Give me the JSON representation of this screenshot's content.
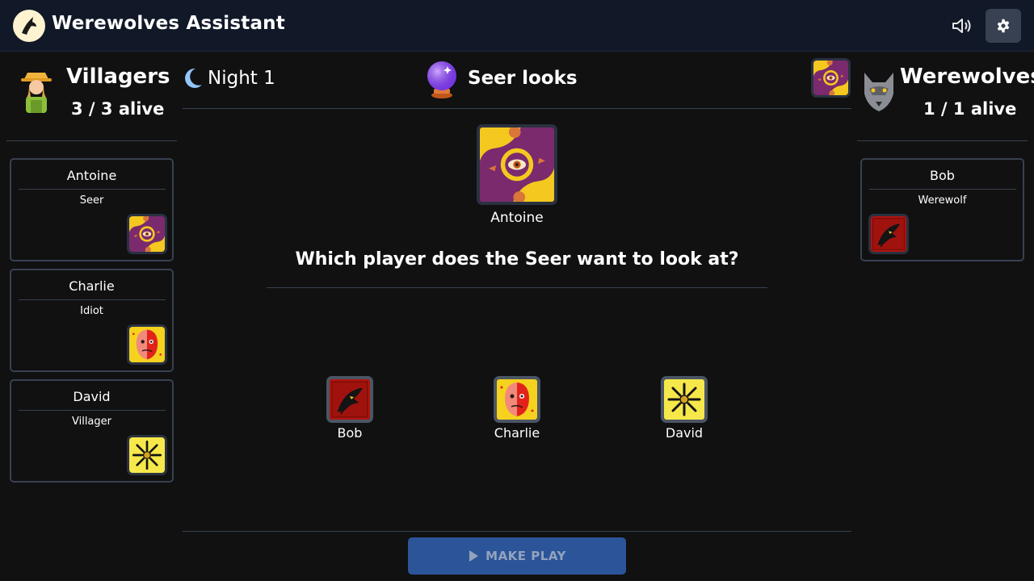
{
  "app": {
    "title": "Werewolves Assistant"
  },
  "header": {
    "sound_icon": "speaker-icon",
    "settings_icon": "gear-icon"
  },
  "villagers": {
    "title": "Villagers",
    "count": "3 / 3 alive"
  },
  "werewolves": {
    "title": "Werewolves",
    "count": "1 / 1 alive"
  },
  "game": {
    "night_label": "Night 1",
    "phase_label": "Seer looks",
    "actor_name": "Antoine",
    "question": "Which player does the Seer want to look at?",
    "targets": [
      {
        "name": "Bob",
        "role_icon": "werewolf"
      },
      {
        "name": "Charlie",
        "role_icon": "idiot"
      },
      {
        "name": "David",
        "role_icon": "villager"
      }
    ],
    "play_button": "MAKE PLAY"
  },
  "villager_players": [
    {
      "name": "Antoine",
      "role": "Seer",
      "role_icon": "seer"
    },
    {
      "name": "Charlie",
      "role": "Idiot",
      "role_icon": "idiot"
    },
    {
      "name": "David",
      "role": "Villager",
      "role_icon": "villager"
    }
  ],
  "werewolf_players": [
    {
      "name": "Bob",
      "role": "Werewolf",
      "role_icon": "werewolf"
    }
  ],
  "colors": {
    "background": "#111111",
    "topbar": "#111827",
    "border": "#374151",
    "button": "#2c5599",
    "seer_purple": "#7b2a6e",
    "seer_yellow": "#f4c81e",
    "werewolf_red": "#b3140f",
    "idiot_red": "#e2231a",
    "villager_yellow": "#f6e84a"
  }
}
